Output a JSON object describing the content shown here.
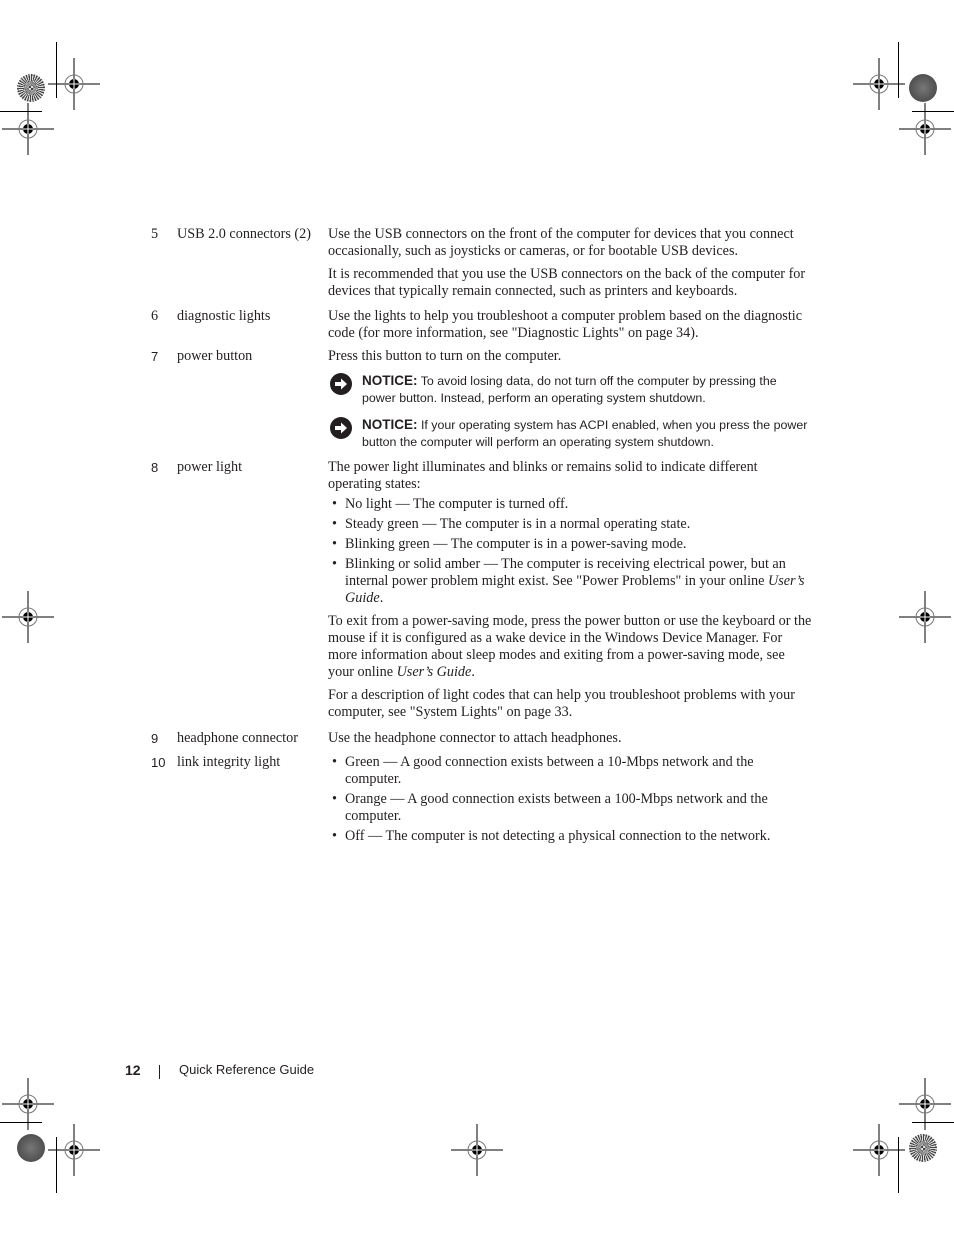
{
  "page": {
    "number": "12",
    "footer_title": "Quick Reference Guide"
  },
  "rows": [
    {
      "num": "5",
      "item": "USB 2.0 connectors (2)",
      "paragraphs": [
        "Use the USB connectors on the front of the computer for devices that you connect occasionally, such as joysticks or cameras, or for bootable USB devices.",
        "It is recommended that you use the USB connectors on the back of the computer for devices that typically remain connected, such as printers and keyboards."
      ]
    },
    {
      "num": "6",
      "item": "diagnostic lights",
      "paragraphs": [
        "Use the lights to help you troubleshoot a computer problem based on the diagnostic code (for more information, see \"Diagnostic Lights\" on page 34)."
      ]
    },
    {
      "num": "7",
      "item": "power button",
      "paragraphs": [
        "Press this button to turn on the computer."
      ],
      "notices": [
        {
          "label": "NOTICE:",
          "text": "To avoid losing data, do not turn off the computer by pressing the power button. Instead, perform an operating system shutdown."
        },
        {
          "label": "NOTICE:",
          "text": "If your operating system has ACPI enabled, when you press the power button the computer will perform an operating system shutdown."
        }
      ]
    },
    {
      "num": "8",
      "item": "power light",
      "intro": "The power light illuminates and blinks or remains solid to indicate different operating states:",
      "bullets": [
        "No light — The computer is turned off.",
        "Steady green — The computer is in a normal operating state.",
        "Blinking green — The computer is in a power-saving mode."
      ],
      "amber_bullet": {
        "text": "Blinking or solid amber — The computer is receiving electrical power, but an internal power problem might exist. See \"Power Problems\" in your online ",
        "italic": "User’s Guide",
        "end": "."
      },
      "exit_para": {
        "text": "To exit from a power-saving mode, press the power button or use the keyboard or the mouse if it is configured as a wake device in the Windows Device Manager. For more information about sleep modes and exiting from a power-saving mode, see your online ",
        "italic": "User’s Guide",
        "end": "."
      },
      "codes_para": "For a description of light codes that can help you troubleshoot problems with your computer, see \"System Lights\" on page 33."
    },
    {
      "num": "9",
      "item": "headphone connector",
      "paragraphs": [
        "Use the headphone connector to attach headphones."
      ]
    },
    {
      "num": "10",
      "item": "link integrity light",
      "bullets": [
        "Green — A good connection exists between a 10-Mbps network and the computer.",
        "Orange — A good connection exists between a 100-Mbps network and the computer.",
        "Off — The computer is not detecting a physical connection to the network."
      ]
    }
  ],
  "icons": {
    "notice": "notice-arrow-icon",
    "bullet": "•"
  }
}
